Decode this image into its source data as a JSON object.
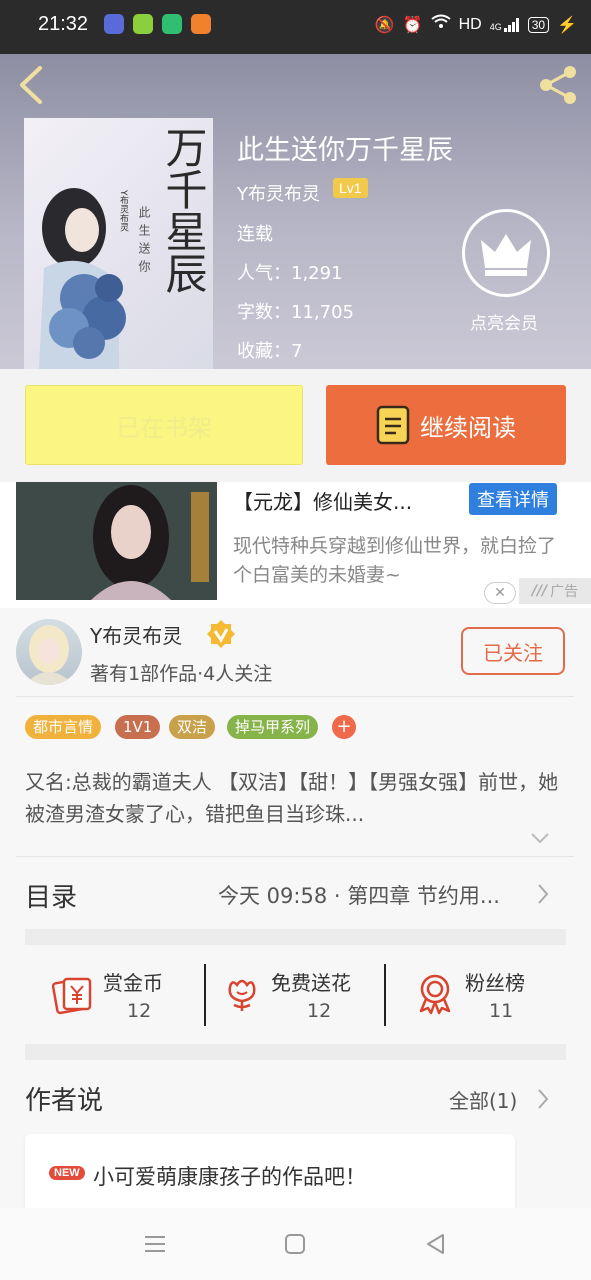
{
  "status_bar": {
    "time": "21:32",
    "network": "HD",
    "signal_label": "4G",
    "battery": "30"
  },
  "book": {
    "cover_title": "万千星辰",
    "cover_subtitle": "此生送你",
    "cover_author": "Y布灵布灵",
    "title": "此生送你万千星辰",
    "author": "Y布灵布灵",
    "author_level": "Lv1",
    "status": "连载",
    "popularity": "人气：1,291",
    "word_count": "字数：11,705",
    "favorites": "收藏：7",
    "vip_label": "点亮会员"
  },
  "actions": {
    "shelf_label": "已在书架",
    "continue_label": "继续阅读"
  },
  "ad": {
    "title": "【元龙】修仙美女...",
    "button": "查看详情",
    "description": "现代特种兵穿越到修仙世界，就白捡了个白富美的未婚妻~",
    "ad_label": "广告"
  },
  "author_card": {
    "name": "Y布灵布灵",
    "info": "著有1部作品·4人关注",
    "follow_label": "已关注"
  },
  "tags": [
    {
      "label": "都市言情",
      "color": "#f0b23c"
    },
    {
      "label": "1V1",
      "color": "#c86f4f"
    },
    {
      "label": "双洁",
      "color": "#c9a14a"
    },
    {
      "label": "掉马甲系列",
      "color": "#86b34a"
    },
    {
      "label": "+",
      "color": "#ee6a4a"
    }
  ],
  "synopsis": "又名:总裁的霸道夫人 【双洁】【甜！】【男强女强】前世，她被渣男渣女蒙了心，错把鱼目当珍珠...",
  "toc": {
    "title": "目录",
    "latest": "今天 09:58 · 第四章 节约用..."
  },
  "stats": [
    {
      "label": "赏金币",
      "value": "12",
      "icon": "coin-icon"
    },
    {
      "label": "免费送花",
      "value": "12",
      "icon": "flower-icon"
    },
    {
      "label": "粉丝榜",
      "value": "11",
      "icon": "medal-icon"
    }
  ],
  "author_says": {
    "title": "作者说",
    "all_label": "全部(1)",
    "new_badge": "NEW",
    "message": "小可爱萌康康孩子的作品吧！"
  },
  "colors": {
    "accent_orange": "#ec6d3e",
    "shelf_yellow": "#fbf582",
    "ad_blue": "#2e7fde"
  }
}
